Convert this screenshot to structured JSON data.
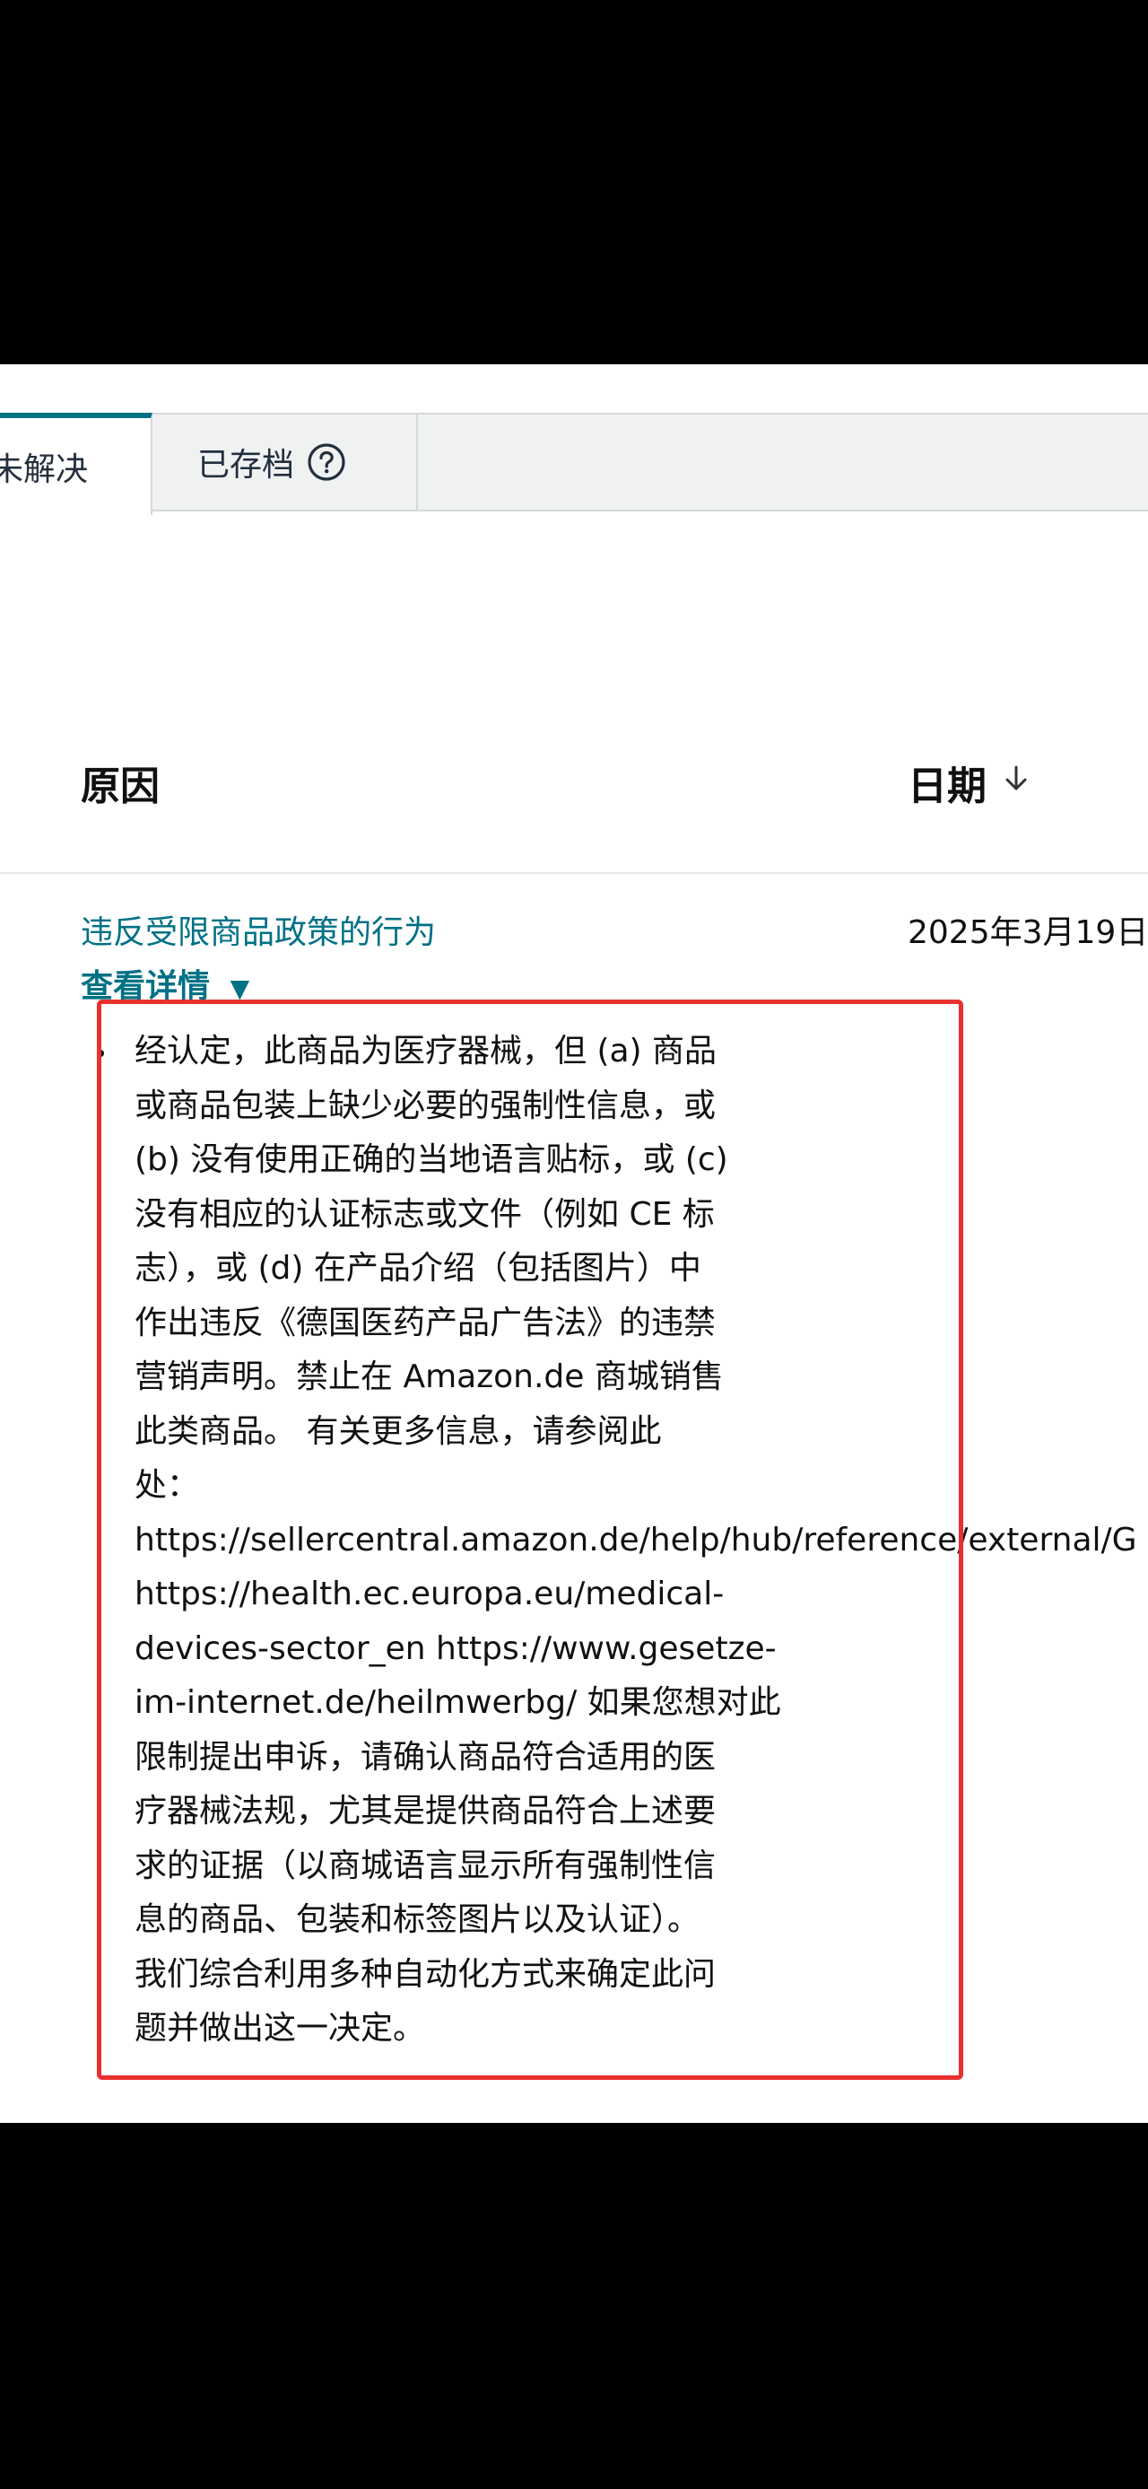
{
  "tabs": {
    "unresolved_label": "未解决",
    "archived_label": "已存档",
    "help_icon": "question-circle-icon"
  },
  "table": {
    "col_reason": "原因",
    "col_date": "日期",
    "sort_icon": "arrow-down-icon",
    "row": {
      "reason": "违反受限商品政策的行为",
      "date": "2025年3月19日",
      "details_toggle": "查看详情",
      "toggle_icon": "triangle-down-icon",
      "detail_lines": [
        "经认定，此商品为医疗器械，但 (a) 商品",
        "或商品包装上缺少必要的强制性信息，或",
        "(b) 没有使用正确的当地语言贴标，或 (c)",
        "没有相应的认证标志或文件（例如 CE 标",
        "志），或 (d) 在产品介绍（包括图片）中",
        "作出违反《德国医药产品广告法》的违禁",
        "营销声明。禁止在 Amazon.de 商城销售",
        "此类商品。 有关更多信息，请参阅此",
        "处：",
        "https://sellercentral.amazon.de/help/hub/reference/external/G",
        "https://health.ec.europa.eu/medical-",
        "devices-sector_en https://www.gesetze-",
        "im-internet.de/heilmwerbg/ 如果您想对此",
        "限制提出申诉，请确认商品符合适用的医",
        "疗器械法规，尤其是提供商品符合上述要",
        "求的证据（以商城语言显示所有强制性信",
        "息的商品、包装和标签图片以及认证）。",
        "我们综合利用多种自动化方式来确定此问",
        "题并做出这一决定。"
      ]
    }
  },
  "colors": {
    "link": "#007185",
    "annotation": "#e8302f",
    "tab_active_border": "#007185"
  }
}
